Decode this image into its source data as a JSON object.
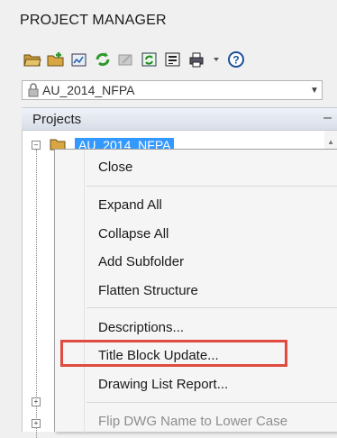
{
  "panel": {
    "title": "PROJECT MANAGER"
  },
  "toolbar": {
    "buttons": [
      "open-project-icon",
      "new-project-icon",
      "new-drawing-icon",
      "refresh-icon",
      "tools-icon",
      "update-icon",
      "properties-icon",
      "print-icon",
      "dropdown-icon",
      "help-icon"
    ]
  },
  "project_combo": {
    "value": "AU_2014_NFPA"
  },
  "projects_header": {
    "label": "Projects",
    "collapse": "–"
  },
  "tree": {
    "selected_item": "AU_2014_NFPA"
  },
  "context_menu": {
    "close": "Close",
    "expand_all": "Expand All",
    "collapse_all": "Collapse All",
    "add_subfolder": "Add Subfolder",
    "flatten_structure": "Flatten Structure",
    "descriptions": "Descriptions...",
    "title_block_update": "Title Block Update...",
    "drawing_list_report": "Drawing List Report...",
    "flip_dwg_name": "Flip DWG Name to Lower Case"
  },
  "colors": {
    "highlight_outline": "#e04a3f",
    "selection": "#3399ff"
  }
}
